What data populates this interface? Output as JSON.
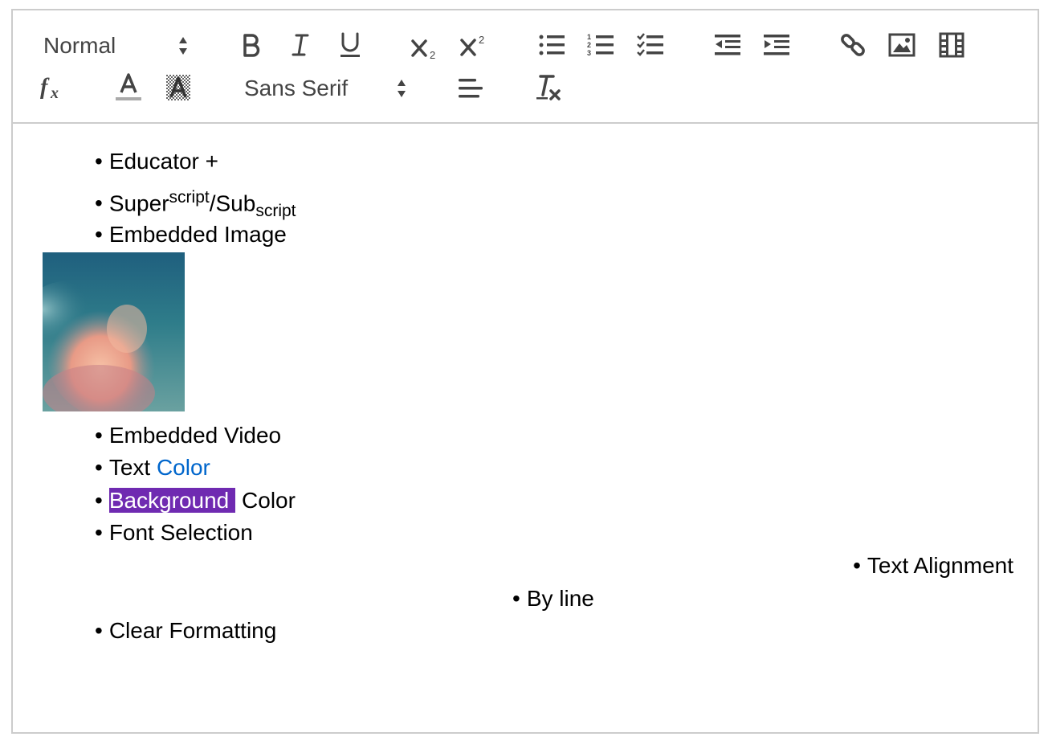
{
  "toolbar": {
    "header_select": "Normal",
    "font_select": "Sans Serif",
    "colors": {
      "icon": "#444444",
      "border": "#cccccc"
    }
  },
  "content": {
    "items": {
      "educator": "Educator +",
      "super_base": "Super",
      "super_sup": "script",
      "sub_mid": "/Sub",
      "sub_sub": "script",
      "embedded_image": "Embedded Image",
      "embedded_video": "Embedded Video",
      "text_prefix": "Text ",
      "text_color": "Color",
      "background_word": "Background",
      "background_rest": " Color",
      "font_selection": "Font Selection",
      "text_alignment": "Text Alignment",
      "by_line": "By line",
      "clear_formatting": "Clear Formatting"
    },
    "bullet": "•",
    "colors": {
      "text_color": "#0066cc",
      "background_color": "#6f2ab1"
    }
  }
}
